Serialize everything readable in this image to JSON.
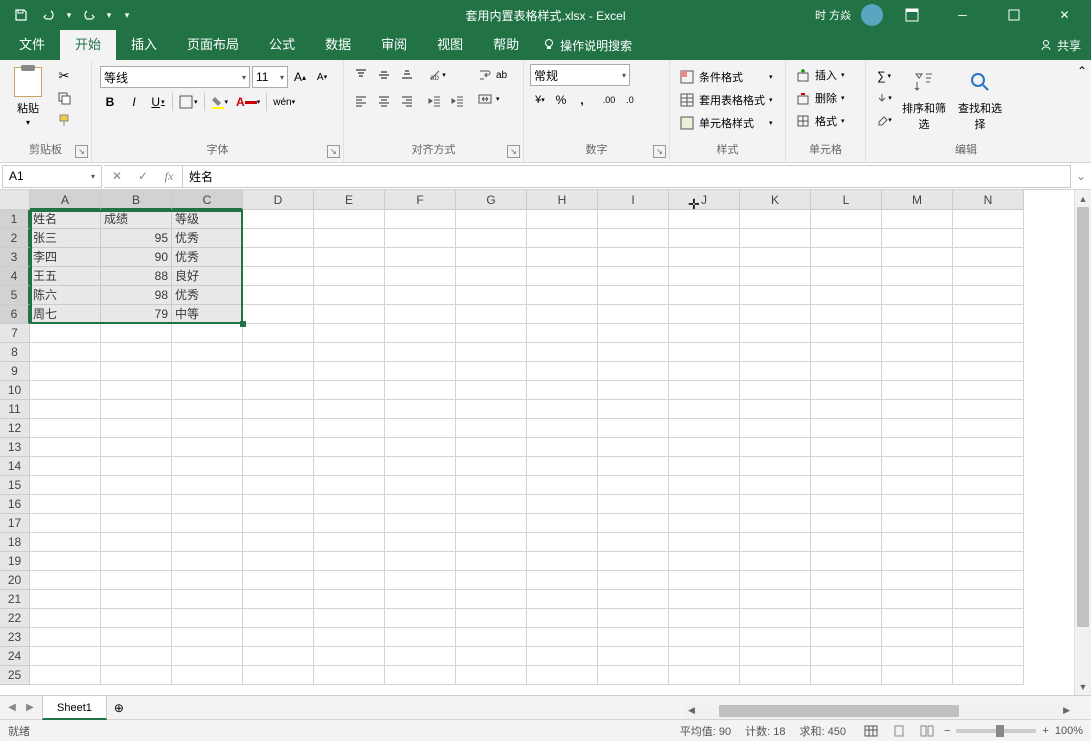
{
  "titlebar": {
    "filename": "套用内置表格样式.xlsx - Excel",
    "user": "时 方焱"
  },
  "tabs": [
    "文件",
    "开始",
    "插入",
    "页面布局",
    "公式",
    "数据",
    "审阅",
    "视图",
    "帮助"
  ],
  "active_tab": "开始",
  "tell_me": "操作说明搜索",
  "share": "共享",
  "ribbon": {
    "clipboard": "剪贴板",
    "paste": "粘贴",
    "font": "字体",
    "font_name": "等线",
    "font_size": "11",
    "bold": "B",
    "italic": "I",
    "underline": "U",
    "alignment": "对齐方式",
    "number": "数字",
    "number_format": "常规",
    "styles": "样式",
    "conditional": "条件格式",
    "table_format": "套用表格格式",
    "cell_styles": "单元格样式",
    "cells": "单元格",
    "insert": "插入",
    "delete": "删除",
    "format": "格式",
    "editing": "编辑",
    "sort_filter": "排序和筛选",
    "find_select": "查找和选择"
  },
  "formula_bar": {
    "name_box": "A1",
    "formula": "姓名"
  },
  "columns": [
    "A",
    "B",
    "C",
    "D",
    "E",
    "F",
    "G",
    "H",
    "I",
    "J",
    "K",
    "L",
    "M",
    "N"
  ],
  "sel_cols": [
    "A",
    "B",
    "C"
  ],
  "sel_rows": [
    1,
    2,
    3,
    4,
    5,
    6
  ],
  "data": {
    "headers": [
      "姓名",
      "成绩",
      "等级"
    ],
    "rows": [
      [
        "张三",
        95,
        "优秀"
      ],
      [
        "李四",
        90,
        "优秀"
      ],
      [
        "王五",
        88,
        "良好"
      ],
      [
        "陈六",
        98,
        "优秀"
      ],
      [
        "周七",
        79,
        "中等"
      ]
    ]
  },
  "sheet": "Sheet1",
  "status": {
    "ready": "就绪",
    "avg_label": "平均值:",
    "avg": "90",
    "count_label": "计数:",
    "count": "18",
    "sum_label": "求和:",
    "sum": "450",
    "zoom": "100%"
  }
}
